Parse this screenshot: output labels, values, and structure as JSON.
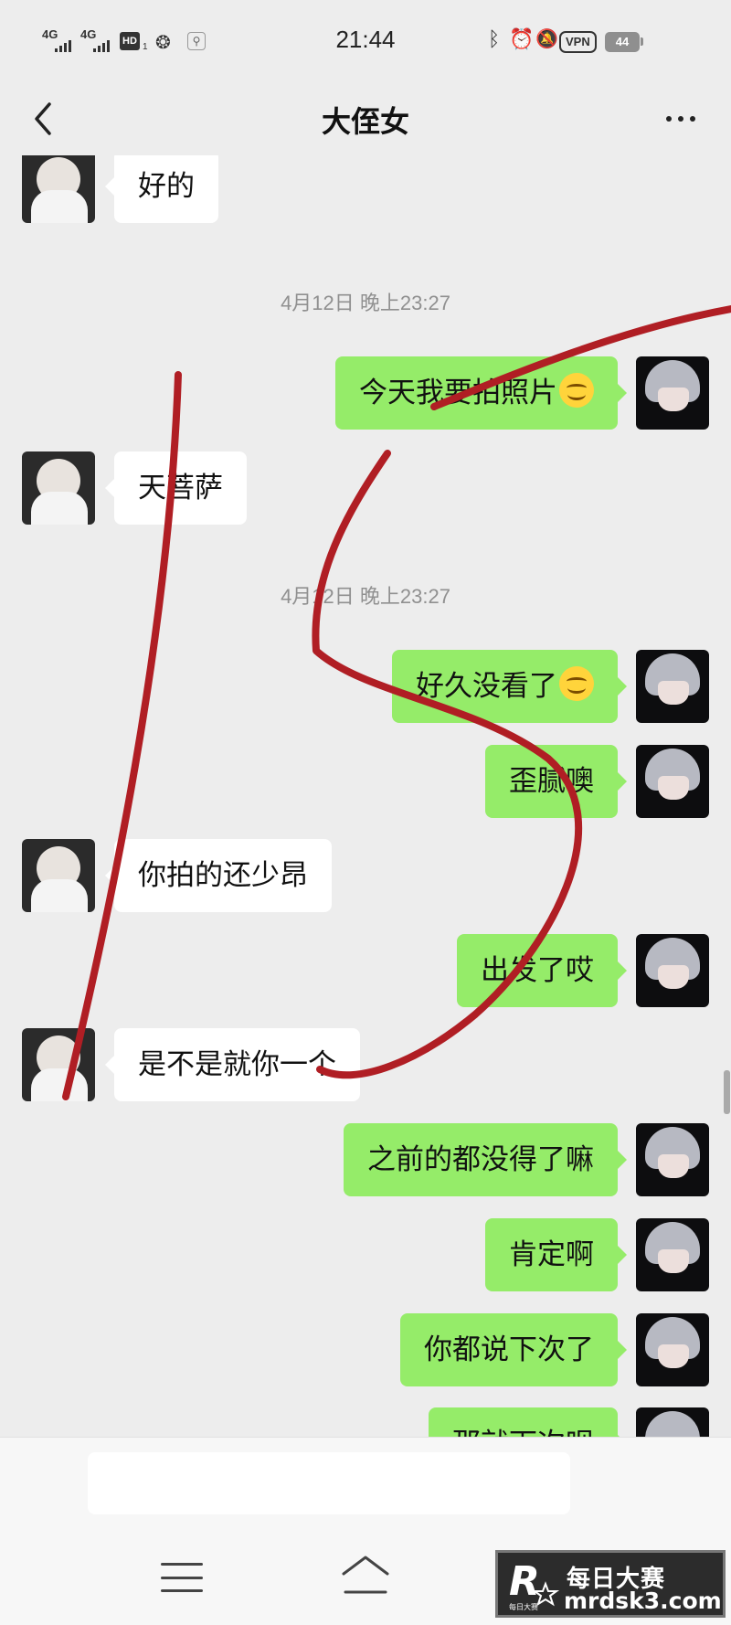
{
  "status_bar": {
    "signal_1": "4G",
    "signal_2": "4G",
    "hd": "HD",
    "hd_sub": "1",
    "time": "21:44",
    "vpn": "VPN",
    "battery": "44",
    "icons": [
      "wechat-icon",
      "location-icon",
      "bluetooth-icon",
      "alarm-icon",
      "mute-icon"
    ]
  },
  "header": {
    "title": "大侄女",
    "back_icon": "chevron-left-icon",
    "more_icon": "more-dots-icon"
  },
  "messages": [
    {
      "sender": "other",
      "text": "好的"
    },
    {
      "type": "time",
      "text": "4月12日 晚上23:27"
    },
    {
      "sender": "self",
      "text": "今天我要拍照片",
      "emoji": "smile-emoji"
    },
    {
      "sender": "other",
      "text": "天菩萨"
    },
    {
      "type": "time",
      "text": "4月12日 晚上23:27"
    },
    {
      "sender": "self",
      "text": "好久没看了",
      "emoji": "smile-emoji"
    },
    {
      "sender": "self",
      "text": "歪腻噢"
    },
    {
      "sender": "other",
      "text": "你拍的还少昂"
    },
    {
      "sender": "self",
      "text": "出发了哎"
    },
    {
      "sender": "other",
      "text": "是不是就你一个"
    },
    {
      "sender": "self",
      "text": "之前的都没得了嘛"
    },
    {
      "sender": "self",
      "text": "肯定啊"
    },
    {
      "sender": "self",
      "text": "你都说下次了"
    },
    {
      "sender": "self",
      "text": "那就下次呗"
    }
  ],
  "input": {
    "placeholder": ""
  },
  "system_nav": {
    "items": [
      "menu-icon",
      "home-icon"
    ]
  },
  "watermark": {
    "logo_letter": "R",
    "logo_small": "每日大赛",
    "name": "每日大赛",
    "url": "mrdsk3.com"
  },
  "colors": {
    "bubble_self": "#95ec69",
    "bubble_other": "#ffffff",
    "background": "#ededed",
    "scribble": "#b01e24"
  }
}
